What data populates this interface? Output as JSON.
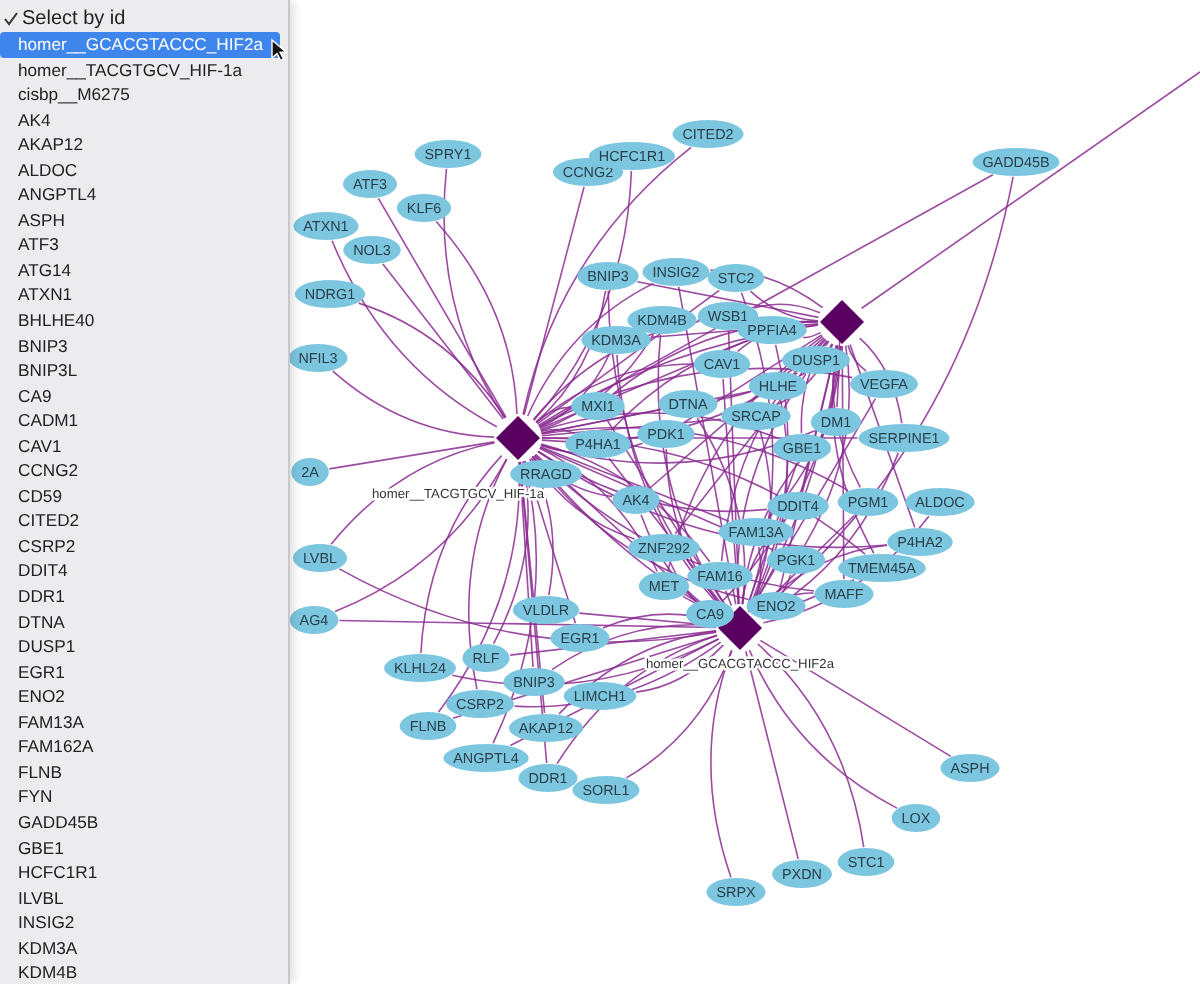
{
  "menu": {
    "header": {
      "label": "Select by id",
      "checked": true
    },
    "items": [
      {
        "label": "homer__GCACGTACCC_HIF2a",
        "selected": true
      },
      {
        "label": "homer__TACGTGCV_HIF-1a",
        "selected": false
      },
      {
        "label": "cisbp__M6275",
        "selected": false
      },
      {
        "label": "AK4",
        "selected": false
      },
      {
        "label": "AKAP12",
        "selected": false
      },
      {
        "label": "ALDOC",
        "selected": false
      },
      {
        "label": "ANGPTL4",
        "selected": false
      },
      {
        "label": "ASPH",
        "selected": false
      },
      {
        "label": "ATF3",
        "selected": false
      },
      {
        "label": "ATG14",
        "selected": false
      },
      {
        "label": "ATXN1",
        "selected": false
      },
      {
        "label": "BHLHE40",
        "selected": false
      },
      {
        "label": "BNIP3",
        "selected": false
      },
      {
        "label": "BNIP3L",
        "selected": false
      },
      {
        "label": "CA9",
        "selected": false
      },
      {
        "label": "CADM1",
        "selected": false
      },
      {
        "label": "CAV1",
        "selected": false
      },
      {
        "label": "CCNG2",
        "selected": false
      },
      {
        "label": "CD59",
        "selected": false
      },
      {
        "label": "CITED2",
        "selected": false
      },
      {
        "label": "CSRP2",
        "selected": false
      },
      {
        "label": "DDIT4",
        "selected": false
      },
      {
        "label": "DDR1",
        "selected": false
      },
      {
        "label": "DTNA",
        "selected": false
      },
      {
        "label": "DUSP1",
        "selected": false
      },
      {
        "label": "EGR1",
        "selected": false
      },
      {
        "label": "ENO2",
        "selected": false
      },
      {
        "label": "FAM13A",
        "selected": false
      },
      {
        "label": "FAM162A",
        "selected": false
      },
      {
        "label": "FLNB",
        "selected": false
      },
      {
        "label": "FYN",
        "selected": false
      },
      {
        "label": "GADD45B",
        "selected": false
      },
      {
        "label": "GBE1",
        "selected": false
      },
      {
        "label": "HCFC1R1",
        "selected": false
      },
      {
        "label": "ILVBL",
        "selected": false
      },
      {
        "label": "INSIG2",
        "selected": false
      },
      {
        "label": "KDM3A",
        "selected": false
      },
      {
        "label": "KDM4B",
        "selected": false
      }
    ]
  },
  "network": {
    "hubs": [
      {
        "kind": "motif",
        "label": "homer__TACGTGCV_HIF-1a"
      },
      {
        "kind": "motif",
        "label": "homer__GCACGTACCC_HIF2a"
      },
      {
        "kind": "motif"
      }
    ],
    "genes": [
      "SPRY1",
      "ATF3",
      "KLF6",
      "ATXN1",
      "NOL3",
      "NDRG1",
      "NFIL3",
      "2A",
      "LVBL",
      "AG4",
      "CCNG2",
      "HCFC1R1",
      "CITED2",
      "GADD45B",
      "BNIP3",
      "INSIG2",
      "STC2",
      "KDM4B",
      "WSB1",
      "PPFIA4",
      "KDM3A",
      "CAV1",
      "HLHE",
      "DUSP1",
      "VEGFA",
      "SRCAP",
      "DM1",
      "MXI1",
      "DTNA",
      "PDK1",
      "P4HA1",
      "RRAGD",
      "AK4",
      "GBE1",
      "SERPINE1",
      "DDIT4",
      "PGM1",
      "ALDOC",
      "P4HA2",
      "TMEM45A",
      "FAM13A",
      "ZNF292",
      "FAM16",
      "PGK1",
      "MAFF",
      "MET",
      "CA9",
      "ENO2",
      "VLDLR",
      "EGR1",
      "KLHL24",
      "RLF",
      "BNIP3",
      "CSRP2",
      "FLNB",
      "AKAP12",
      "LIMCH1",
      "ANGPTL4",
      "DDR1",
      "SORL1",
      "ASPH",
      "LOX",
      "STC1",
      "PXDN",
      "SRPX"
    ]
  }
}
